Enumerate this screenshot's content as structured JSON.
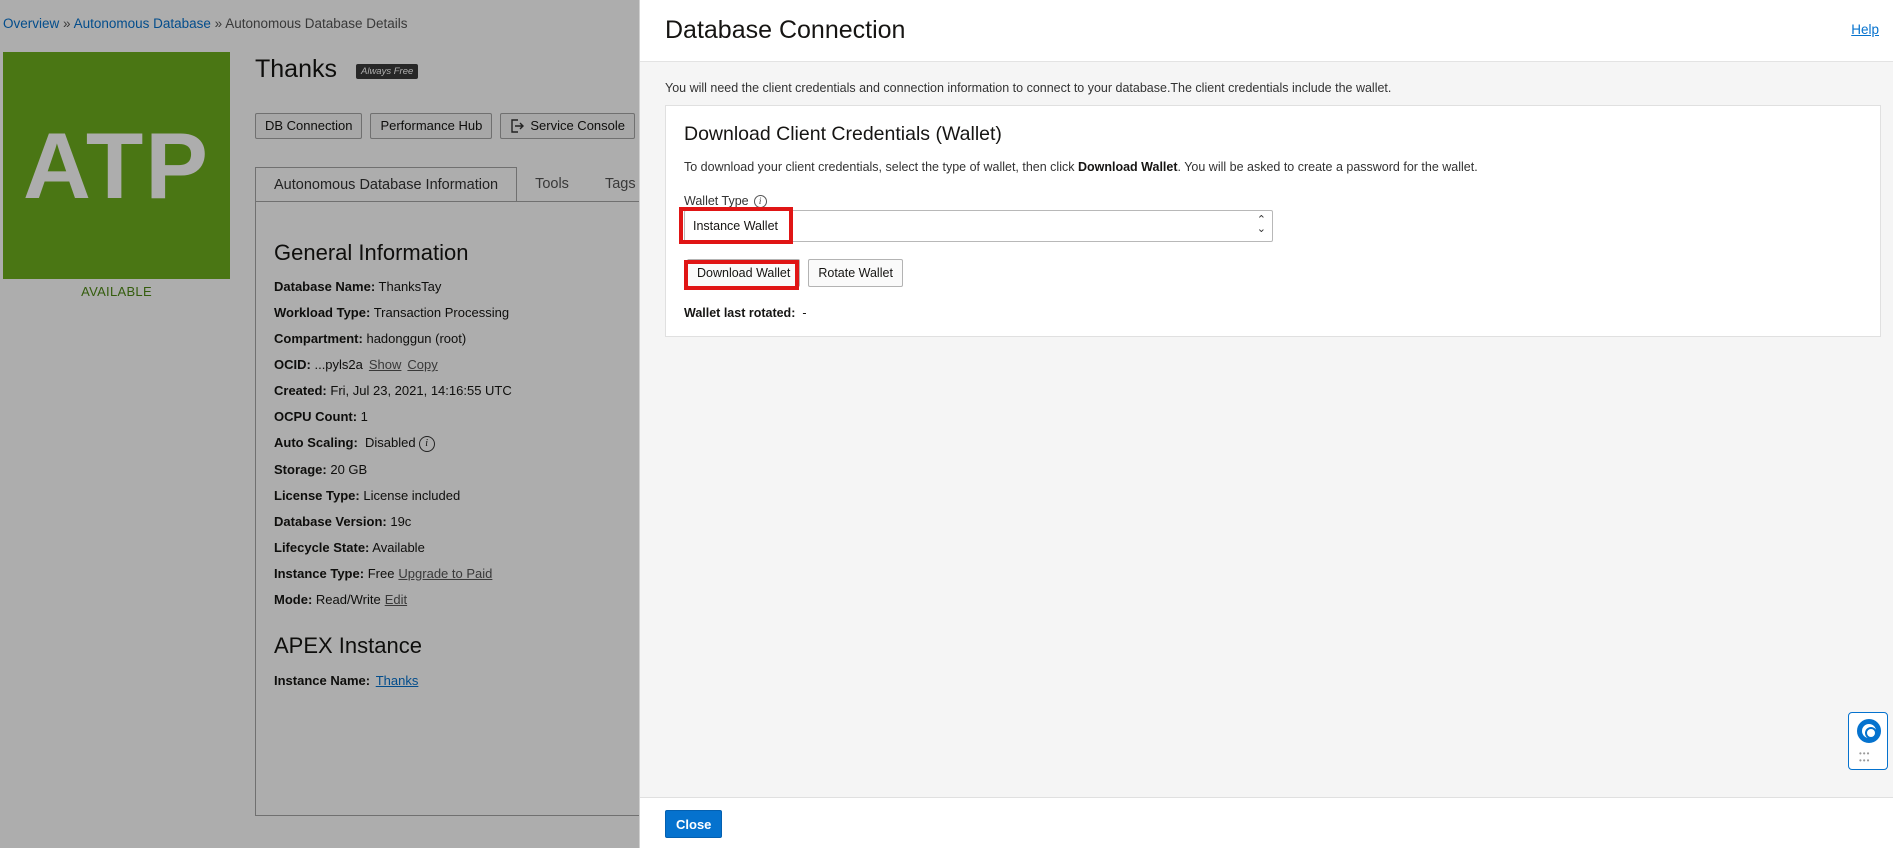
{
  "breadcrumb": {
    "items": [
      "Overview",
      "Autonomous Database",
      "Autonomous Database Details"
    ],
    "separator": "»"
  },
  "logo": {
    "text": "ATP",
    "color": "#6eae1e"
  },
  "status": "AVAILABLE",
  "database": {
    "name": "Thanks",
    "badge": "Always Free"
  },
  "actions": [
    "DB Connection",
    "Performance Hub",
    "Service Console"
  ],
  "tabs": [
    "Autonomous Database Information",
    "Tools",
    "Tags"
  ],
  "general": {
    "title": "General Information",
    "db_name_label": "Database Name:",
    "db_name": "ThanksTay",
    "workload_label": "Workload Type:",
    "workload": "Transaction Processing",
    "compartment_label": "Compartment:",
    "compartment": "hadonggun (root)",
    "ocid_label": "OCID:",
    "ocid": "...pyls2a",
    "ocid_show": "Show",
    "ocid_copy": "Copy",
    "created_label": "Created:",
    "created": "Fri, Jul 23, 2021, 14:16:55 UTC",
    "ocpu_label": "OCPU Count:",
    "ocpu": "1",
    "autoscale_label": "Auto Scaling:",
    "autoscale": "Disabled",
    "storage_label": "Storage:",
    "storage": "20 GB",
    "license_label": "License Type:",
    "license": "License included",
    "version_label": "Database Version:",
    "version": "19c",
    "lifecycle_label": "Lifecycle State:",
    "lifecycle": "Available",
    "instance_label": "Instance Type:",
    "instance": "Free",
    "instance_link": "Upgrade to Paid",
    "mode_label": "Mode:",
    "mode": "Read/Write",
    "mode_link": "Edit"
  },
  "apex": {
    "title": "APEX Instance",
    "name_label": "Instance Name:",
    "name": "Thanks"
  },
  "dialog": {
    "title": "Database Connection",
    "help": "Help",
    "intro": "You will need the client credentials and connection information to connect to your database.The client credentials include the wallet.",
    "cred_title": "Download Client Credentials (Wallet)",
    "cred_desc_1": "To download your client credentials, select the type of wallet, then click ",
    "cred_desc_bold": "Download Wallet",
    "cred_desc_2": ". You will be asked to create a password for the wallet.",
    "wallet_type_label": "Wallet Type",
    "wallet_type_value": "Instance Wallet",
    "download_label": "Download Wallet",
    "rotate_label": "Rotate Wallet",
    "last_rotated_label": "Wallet last rotated:",
    "last_rotated_value": "-",
    "close_label": "Close"
  },
  "colors": {
    "accent": "#0572ce",
    "highlight": "#e01515",
    "brand_green": "#6eae1e"
  }
}
